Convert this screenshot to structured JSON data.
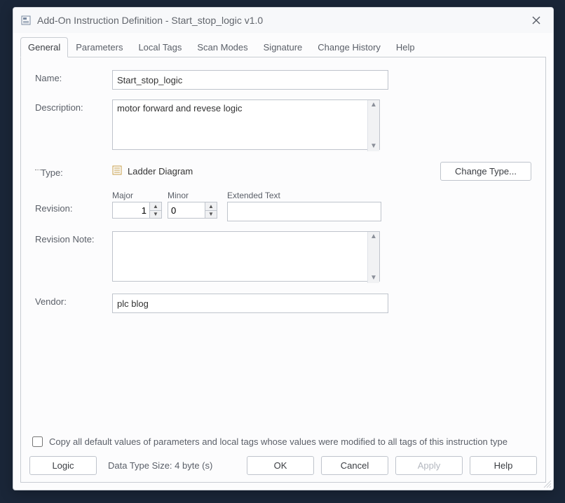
{
  "window": {
    "title": "Add-On Instruction Definition - Start_stop_logic v1.0"
  },
  "tabs": [
    "General",
    "Parameters",
    "Local Tags",
    "Scan Modes",
    "Signature",
    "Change History",
    "Help"
  ],
  "active_tab": 0,
  "form": {
    "name_label": "Name:",
    "name_value": "Start_stop_logic",
    "description_label": "Description:",
    "description_value": "motor forward and revese logic",
    "type_label": "Type:",
    "type_value": "Ladder Diagram",
    "change_type_label": "Change Type...",
    "revision_label": "Revision:",
    "major_label": "Major",
    "major_value": "1",
    "minor_label": "Minor",
    "minor_value": "0",
    "extended_label": "Extended Text",
    "extended_value": "",
    "revision_note_label": "Revision Note:",
    "revision_note_value": "",
    "vendor_label": "Vendor:",
    "vendor_value": "plc blog"
  },
  "footer": {
    "copy_label": "Copy all default values of parameters and local tags whose values were modified to all tags of this instruction type",
    "logic_label": "Logic",
    "data_size_label": "Data Type Size: 4 byte (s)",
    "ok_label": "OK",
    "cancel_label": "Cancel",
    "apply_label": "Apply",
    "help_label": "Help"
  }
}
